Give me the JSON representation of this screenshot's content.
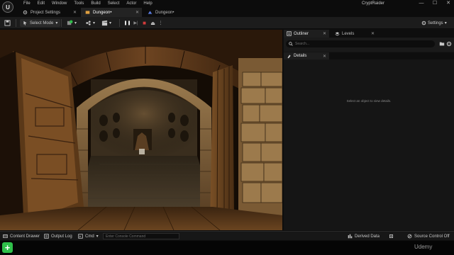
{
  "app": {
    "logo": "U",
    "menu": [
      "File",
      "Edit",
      "Window",
      "Tools",
      "Build",
      "Select",
      "Actor",
      "Help"
    ],
    "project_name": "CryptRaider",
    "window_controls": {
      "minimize": "—",
      "maximize": "☐",
      "close": "✕"
    }
  },
  "tabs": [
    {
      "label": "Project Settings",
      "close": "✕",
      "icon": "gear-icon"
    },
    {
      "label": "Dungeon•",
      "close": "✕",
      "icon": "level-icon",
      "active": true
    },
    {
      "label": "Dungeon•",
      "close": "",
      "icon": "blueprint-icon"
    }
  ],
  "toolbar": {
    "save_icon": "save-icon",
    "select_mode": "Select Mode",
    "settings": "Settings",
    "dropdown": "▾",
    "play_controls": {
      "pause": "❚❚",
      "step": "▶|",
      "stop": "■",
      "eject": "⏏",
      "more": "⋮"
    }
  },
  "outliner": {
    "tabs": [
      {
        "label": "Outliner",
        "close": "✕",
        "active": true
      },
      {
        "label": "Levels",
        "close": "✕"
      }
    ],
    "search_placeholder": "Search..."
  },
  "details": {
    "tab_label": "Details",
    "tab_close": "✕",
    "empty_message": "Select an object to view details."
  },
  "statusbar": {
    "content_drawer": "Content Drawer",
    "output_log": "Output Log",
    "cmd": "Cmd",
    "cmd_placeholder": "Enter Console Command",
    "derived_data": "Derived Data",
    "source_control": "Source Control Off"
  },
  "bottom": {
    "fab": "+",
    "watermark": "Udemy"
  },
  "colors": {
    "accent_orange": "#e0a040",
    "stop_red": "#d23b3b",
    "fab_green": "#2fbf4a",
    "panel_bg": "#151515"
  }
}
